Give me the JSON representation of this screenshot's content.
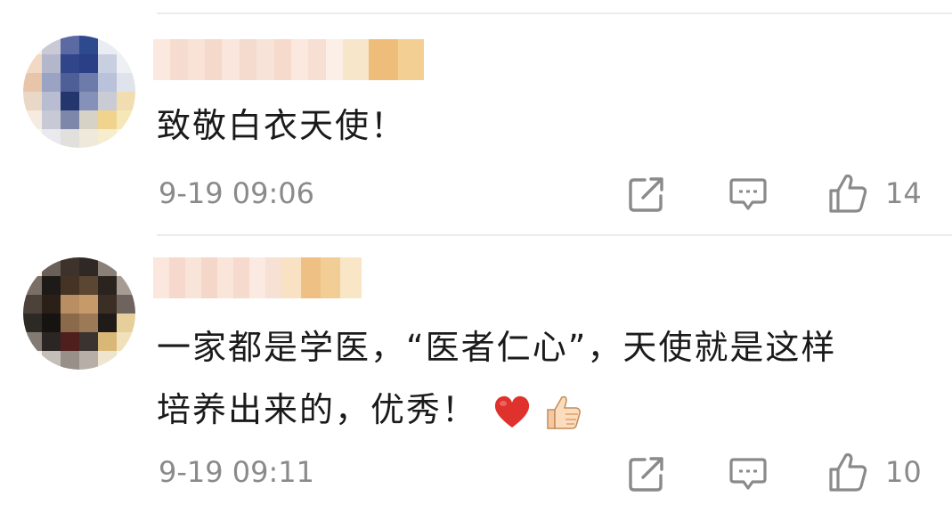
{
  "comments": [
    {
      "text": "致敬白衣天使！",
      "timestamp": "9-19 09:06",
      "likes": "14"
    },
    {
      "text_line1": "一家都是学医，“医者仁心”，天使就是这样",
      "text_line2": "培养出来的，优秀！",
      "emojis": [
        "heart-emoji",
        "thumbs-up-emoji"
      ],
      "timestamp": "9-19 09:11",
      "likes": "10"
    }
  ],
  "icons": [
    "share-icon",
    "reply-icon",
    "like-icon"
  ],
  "colors": {
    "text": "#1a1a1a",
    "meta": "#8a8a8a",
    "heart": "#e0322d"
  }
}
